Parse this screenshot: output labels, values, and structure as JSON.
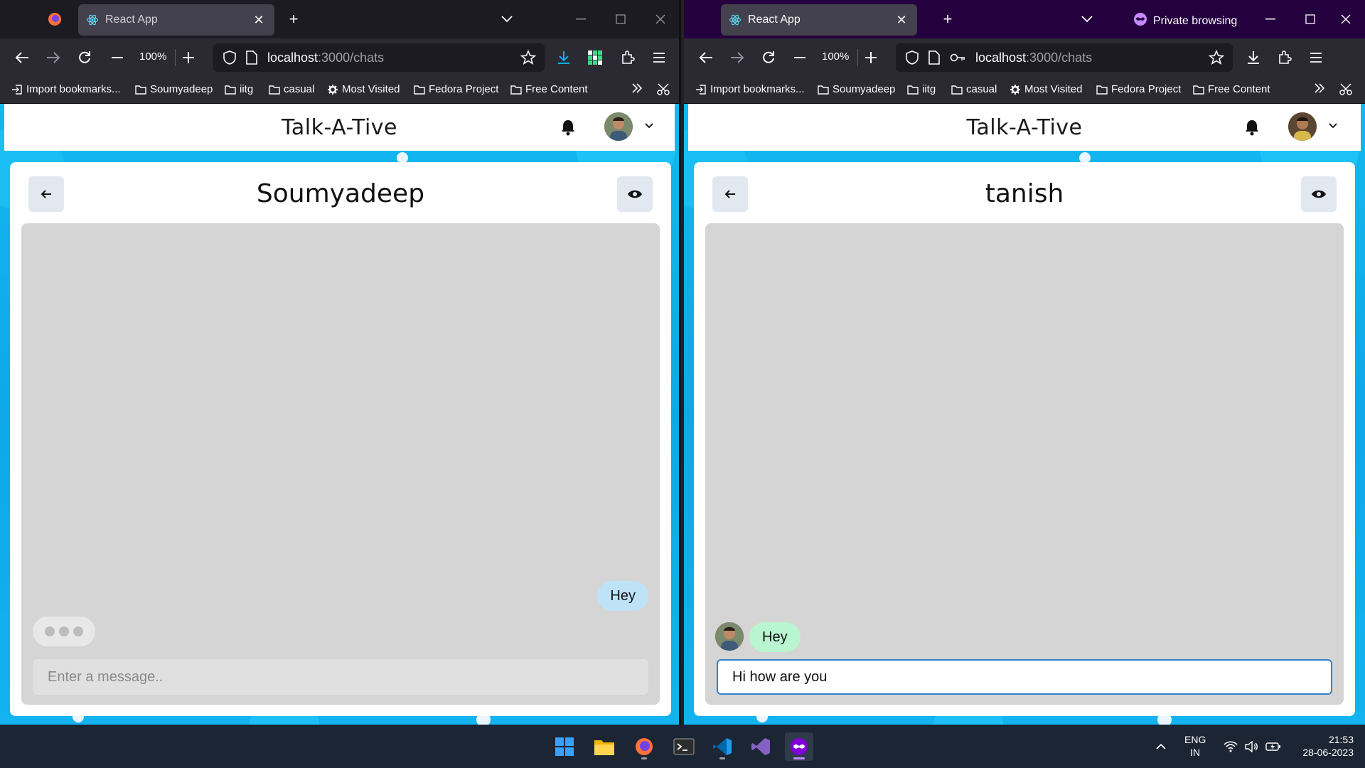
{
  "left_window": {
    "tab": {
      "title": "React App",
      "close": "✕"
    },
    "new_tab": "+",
    "zoom": "100%",
    "url": {
      "host": "localhost",
      "path": ":3000/chats"
    },
    "bookmarks": [
      "Import bookmarks...",
      "Soumyadeep",
      "iitg",
      "casual",
      "Most Visited",
      "Fedora Project",
      "Free Content"
    ],
    "app": {
      "title": "Talk-A-Tive",
      "chat_name": "Soumyadeep",
      "messages": [
        {
          "text": "Hey",
          "side": "sent"
        }
      ],
      "typing_indicator": true,
      "input_placeholder": "Enter a message..",
      "input_value": ""
    }
  },
  "right_window": {
    "tab": {
      "title": "React App",
      "close": "✕"
    },
    "new_tab": "+",
    "private_label": "Private browsing",
    "zoom": "100%",
    "url": {
      "host": "localhost",
      "path": ":3000/chats"
    },
    "bookmarks": [
      "Import bookmarks...",
      "Soumyadeep",
      "iitg",
      "casual",
      "Most Visited",
      "Fedora Project",
      "Free Content"
    ],
    "app": {
      "title": "Talk-A-Tive",
      "chat_name": "tanish",
      "messages": [
        {
          "text": "Hey",
          "side": "received"
        }
      ],
      "input_value": "Hi how are you"
    }
  },
  "taskbar": {
    "language": "ENG",
    "region": "IN",
    "time": "21:53",
    "date": "28-06-2023"
  },
  "colors": {
    "app_background": "#13b8f0",
    "chat_area": "#d5d5d5",
    "sent_bubble": "#bee3f8",
    "received_bubble": "#b9f5d0",
    "input_focus_border": "#3182ce"
  }
}
